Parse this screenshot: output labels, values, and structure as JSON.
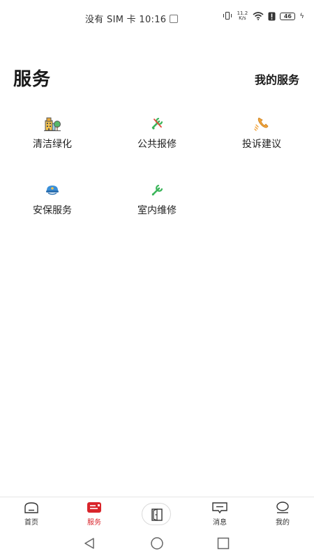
{
  "status_bar": {
    "carrier_time": "没有 SIM 卡 10:16",
    "net_speed_value": "11.2",
    "net_speed_unit": "K/s",
    "battery": "46"
  },
  "header": {
    "title": "服务",
    "my_services": "我的服务"
  },
  "services": [
    {
      "label": "清洁绿化",
      "icon": "building-tree-icon"
    },
    {
      "label": "公共报修",
      "icon": "wrench-screwdriver-icon"
    },
    {
      "label": "投诉建议",
      "icon": "phone-icon"
    },
    {
      "label": "安保服务",
      "icon": "security-cap-icon"
    },
    {
      "label": "室内维修",
      "icon": "wrench-icon"
    }
  ],
  "bottom_nav": {
    "items": [
      {
        "label": "首页",
        "icon": "home-icon"
      },
      {
        "label": "服务",
        "icon": "service-icon",
        "active": true
      },
      {
        "label": "",
        "icon": "door-icon"
      },
      {
        "label": "消息",
        "icon": "message-icon"
      },
      {
        "label": "我的",
        "icon": "profile-icon"
      }
    ]
  },
  "colors": {
    "accent": "#d9252b",
    "green": "#3bb55a",
    "orange": "#f2a33a",
    "blue": "#3a8fd8"
  }
}
